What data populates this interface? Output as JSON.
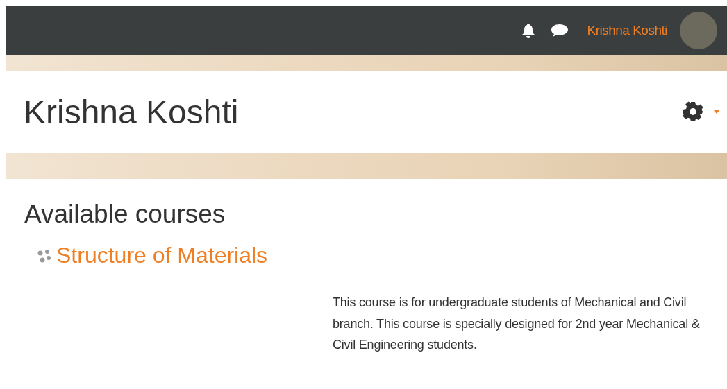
{
  "navbar": {
    "user_name": "Krishna Koshti"
  },
  "page_header": {
    "title": "Krishna Koshti"
  },
  "main": {
    "heading": "Available courses",
    "courses": [
      {
        "name": "Structure of Materials",
        "summary": "This course is for undergraduate students of Mechanical and Civil branch. This course is specially designed for 2nd year Mechanical & Civil Engineering students."
      }
    ]
  }
}
